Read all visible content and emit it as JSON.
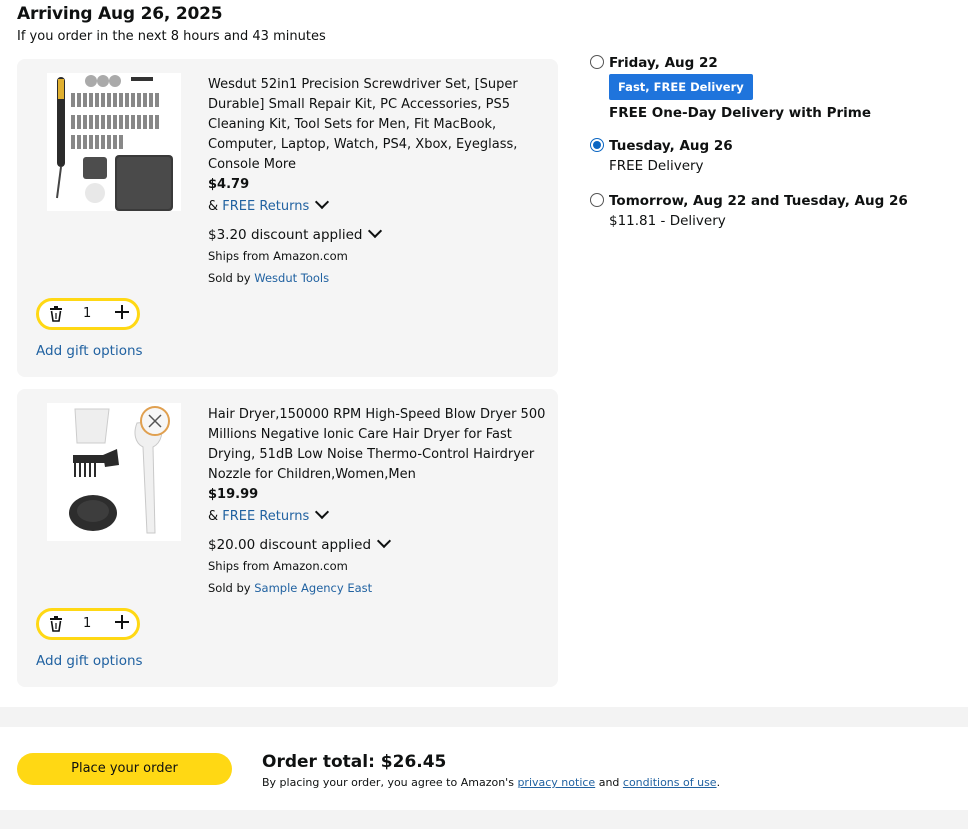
{
  "delivery": {
    "heading": "Arriving Aug 26, 2025",
    "subheading": "If you order in the next 8 hours and 43 minutes"
  },
  "items": [
    {
      "title": "Wesdut 52in1 Precision Screwdriver Set, [Super Durable] Small Repair Kit, PC Accessories, PS5 Cleaning Kit, Tool Sets for Men, Fit MacBook, Computer, Laptop, Watch, PS4, Xbox, Eyeglass, Console More",
      "price": "$4.79",
      "returns_prefix": "&",
      "returns_link": "FREE Returns",
      "discount": "$3.20 discount applied",
      "ships_from": "Ships from Amazon.com",
      "sold_by_prefix": "Sold by",
      "seller": "Wesdut Tools",
      "quantity": "1",
      "gift": "Add gift options",
      "image_icon": "screwdriver-kit-image"
    },
    {
      "title": "Hair Dryer,150000 RPM High-Speed Blow Dryer 500 Millions Negative Ionic Care Hair Dryer for Fast Drying, 51dB Low Noise Thermo-Control Hairdryer Nozzle for Children,Women,Men",
      "price": "$19.99",
      "returns_prefix": "&",
      "returns_link": "FREE Returns",
      "discount": "$20.00 discount applied",
      "ships_from": "Ships from Amazon.com",
      "sold_by_prefix": "Sold by",
      "seller": "Sample Agency East",
      "quantity": "1",
      "gift": "Add gift options",
      "image_icon": "hair-dryer-image"
    }
  ],
  "delivery_options": [
    {
      "date": "Friday, Aug 22",
      "badge": "Fast, FREE Delivery",
      "detail": "FREE One-Day Delivery with Prime",
      "selected": false
    },
    {
      "date": "Tuesday, Aug 26",
      "detail": "FREE Delivery",
      "selected": true
    },
    {
      "date": "Tomorrow, Aug 22 and Tuesday, Aug 26",
      "detail": "$11.81 - Delivery",
      "selected": false
    }
  ],
  "checkout": {
    "button_label": "Place your order",
    "order_total": "Order total: $26.45",
    "legal_prefix": "By placing your order, you agree to Amazon's",
    "privacy_link": "privacy notice",
    "legal_mid": "and",
    "conditions_link": "conditions of use",
    "legal_suffix": "."
  },
  "colors": {
    "accent_yellow": "#ffd814",
    "link_blue": "#2162a1",
    "badge_blue": "#1f74dc",
    "card_bg": "#f5f5f5"
  }
}
